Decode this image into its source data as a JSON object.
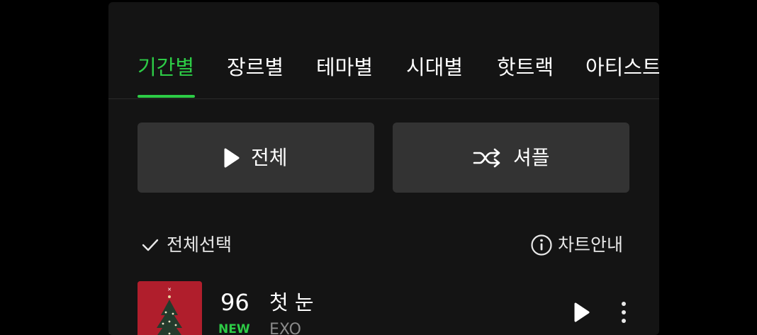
{
  "tabs": [
    {
      "label": "기간별",
      "active": true
    },
    {
      "label": "장르별",
      "active": false
    },
    {
      "label": "테마별",
      "active": false
    },
    {
      "label": "시대별",
      "active": false
    },
    {
      "label": "핫트랙",
      "active": false
    },
    {
      "label": "아티스트",
      "active": false
    }
  ],
  "actions": {
    "play_all_label": "전체",
    "shuffle_label": "셔플",
    "play_icon": "play-icon",
    "shuffle_icon": "shuffle-icon"
  },
  "list_controls": {
    "select_all_label": "전체선택",
    "chart_info_label": "차트안내",
    "check_icon": "check-icon",
    "info_icon": "info-icon"
  },
  "songs": [
    {
      "rank": "96",
      "title": "첫 눈",
      "artist": "EXO",
      "badge": "NEW"
    }
  ],
  "colors": {
    "accent": "#2dcc46",
    "background": "#000000",
    "panel": "#141414",
    "button": "#333333",
    "album": "#b01e2c"
  }
}
